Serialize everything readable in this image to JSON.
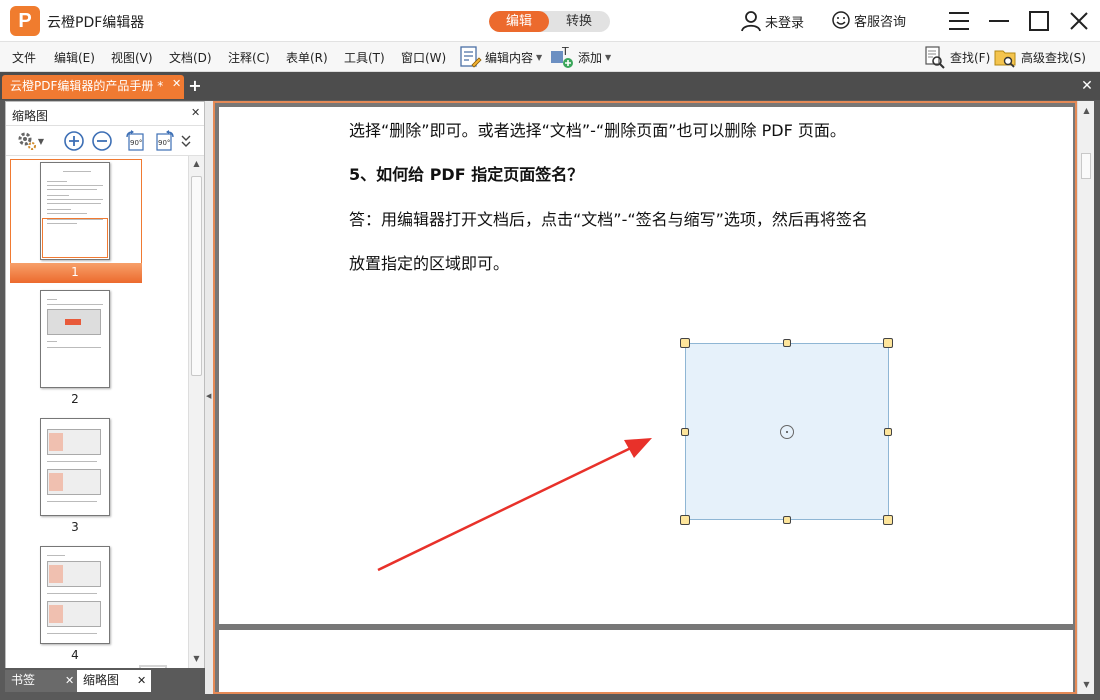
{
  "app": {
    "logo_text": "P",
    "title": "云橙PDF编辑器",
    "mode_tabs": [
      "编辑",
      "转换"
    ],
    "active_mode": "编辑",
    "user_label": "未登录",
    "service_label": "客服咨询"
  },
  "menu": {
    "items": [
      "文件",
      "编辑(E)",
      "视图(V)",
      "文档(D)",
      "注释(C)",
      "表单(R)",
      "工具(T)",
      "窗口(W)"
    ],
    "edit_content": "编辑内容",
    "add": "添加",
    "find": "查找(F)",
    "advanced_find": "高级查找(S)"
  },
  "tabs": {
    "document_tab": "云橙PDF编辑器的产品手册 *"
  },
  "left_panel": {
    "title": "缩略图",
    "rotate_left_label": "90°",
    "rotate_right_label": "90°",
    "thumbnails": [
      "1",
      "2",
      "3",
      "4"
    ],
    "selected_thumbnail": "1",
    "bottom_tabs": [
      "书签",
      "缩略图"
    ],
    "active_bottom_tab": "缩略图"
  },
  "document": {
    "lines": [
      "选择“删除”即可。或者选择“文档”-“删除页面”也可以删除 PDF 页面。",
      "5、如何给  PDF  指定页面签名？",
      "答：用编辑器打开文档后，点击“文档”-“签名与缩写”选项，然后再将签名",
      "放置指定的区域即可。"
    ]
  },
  "colors": {
    "accent": "#ec6a2d",
    "tab_bar": "#4d4d4d",
    "selection_fill": "#e3eef8",
    "arrow": "#e8312a"
  }
}
